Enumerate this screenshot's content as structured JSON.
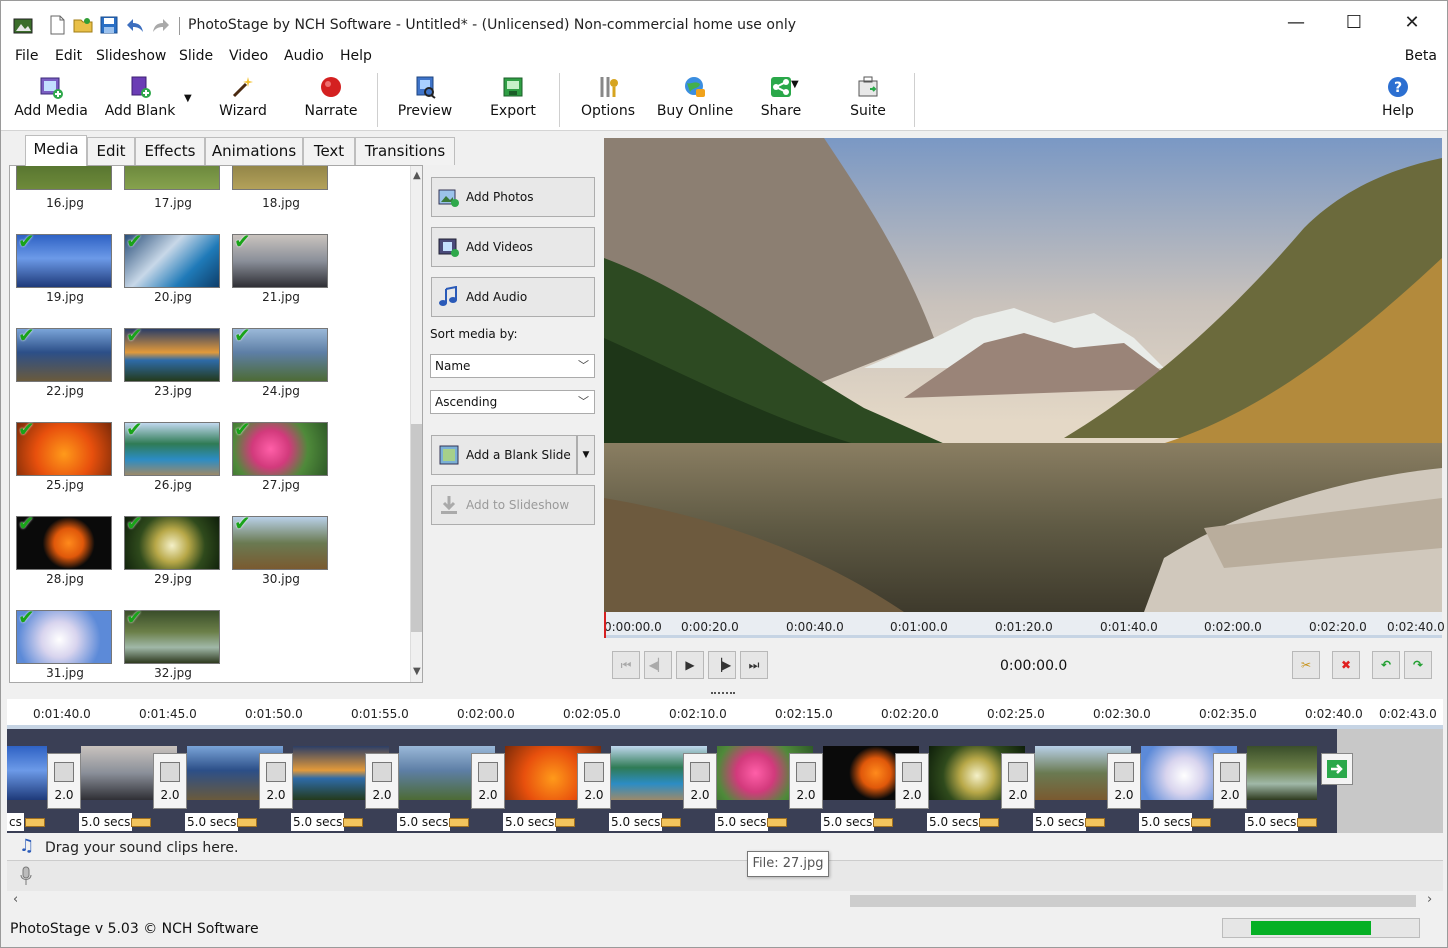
{
  "window": {
    "title": "PhotoStage by NCH Software - Untitled* - (Unlicensed) Non-commercial home use only",
    "minimize": "—",
    "maximize": "☐",
    "close": "✕"
  },
  "menu": {
    "items": [
      "File",
      "Edit",
      "Slideshow",
      "Slide",
      "Video",
      "Audio",
      "Help"
    ],
    "beta": "Beta"
  },
  "toolbar": {
    "add_media": "Add Media",
    "add_blank": "Add Blank",
    "wizard": "Wizard",
    "narrate": "Narrate",
    "preview": "Preview",
    "export": "Export",
    "options": "Options",
    "buy_online": "Buy Online",
    "share": "Share",
    "suite": "Suite",
    "help": "Help"
  },
  "tabs": [
    "Media",
    "Edit",
    "Effects",
    "Animations",
    "Text",
    "Transitions"
  ],
  "media": {
    "files": [
      "16.jpg",
      "17.jpg",
      "18.jpg",
      "19.jpg",
      "20.jpg",
      "21.jpg",
      "22.jpg",
      "23.jpg",
      "24.jpg",
      "25.jpg",
      "26.jpg",
      "27.jpg",
      "28.jpg",
      "29.jpg",
      "30.jpg",
      "31.jpg",
      "32.jpg"
    ]
  },
  "actions": {
    "add_photos": "Add Photos",
    "add_videos": "Add Videos",
    "add_audio": "Add Audio",
    "sort_label": "Sort media by:",
    "sort_field": "Name",
    "sort_order": "Ascending",
    "add_blank_slide": "Add a Blank Slide",
    "add_to_slideshow": "Add to Slideshow"
  },
  "preview": {
    "ruler": [
      "0:00:00.0",
      "0:00:20.0",
      "0:00:40.0",
      "0:01:00.0",
      "0:01:20.0",
      "0:01:40.0",
      "0:02:00.0",
      "0:02:20.0",
      "0:02:40.0"
    ],
    "timecode": "0:00:00.0"
  },
  "timeline": {
    "ruler": [
      "0:01:40.0",
      "0:01:45.0",
      "0:01:50.0",
      "0:01:55.0",
      "0:02:00.0",
      "0:02:05.0",
      "0:02:10.0",
      "0:02:15.0",
      "0:02:20.0",
      "0:02:25.0",
      "0:02:30.0",
      "0:02:35.0",
      "0:02:40.0",
      "0:02:43.0"
    ],
    "transition": "2.0",
    "duration": "5.0 secs",
    "first_duration": "cs",
    "sound_hint": "Drag your sound clips here.",
    "tooltip": "File: 27.jpg"
  },
  "status": {
    "text": "PhotoStage v 5.03 © NCH Software",
    "progress": 0.72
  },
  "colors": {
    "accent": "#06b025",
    "check": "#19a319",
    "track": "#3a3f55"
  }
}
